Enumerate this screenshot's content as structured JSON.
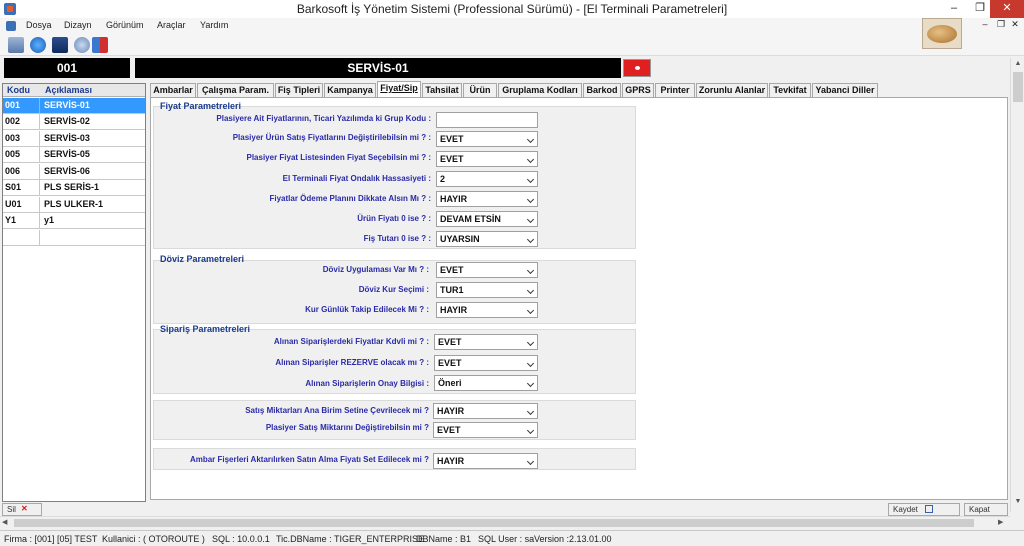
{
  "window": {
    "title": "Barkosoft İş Yönetim Sistemi (Professional Sürümü) - [El Terminali Parametreleri]",
    "minimize": "–",
    "restore": "❐",
    "close": "✕"
  },
  "menu": {
    "items": [
      "Dosya",
      "Dizayn",
      "Görünüm",
      "Araçlar",
      "Yardım"
    ],
    "mdi_minimize": "–",
    "mdi_restore": "❐",
    "mdi_close": "✕"
  },
  "toolbar": {
    "icons": [
      "users-icon",
      "globe-icon",
      "monitor-icon",
      "network-icon",
      "exit-icon"
    ]
  },
  "header": {
    "code": "001",
    "name": "SERVİS-01"
  },
  "list": {
    "col_code": "Kodu",
    "col_desc": "Açıklaması",
    "rows": [
      {
        "code": "001",
        "desc": "SERVİS-01"
      },
      {
        "code": "002",
        "desc": "SERVİS-02"
      },
      {
        "code": "003",
        "desc": "SERVİS-03"
      },
      {
        "code": "005",
        "desc": "SERVİS-05"
      },
      {
        "code": "006",
        "desc": "SERVİS-06"
      },
      {
        "code": "S01",
        "desc": "PLS SERİS-1"
      },
      {
        "code": "U01",
        "desc": "PLS ULKER-1"
      },
      {
        "code": "Y1",
        "desc": "y1"
      },
      {
        "code": "",
        "desc": ""
      }
    ]
  },
  "tabs": [
    "Ambarlar",
    "Çalışma Param.",
    "Fiş Tipleri",
    "Kampanya",
    "Fiyat/Sip",
    "Tahsilat",
    "Ürün",
    "Gruplama Kodları",
    "Barkod",
    "GPRS",
    "Printer",
    "Zorunlu Alanlar",
    "Tevkifat",
    "Yabanci Diller"
  ],
  "active_tab": "Fiyat/Sip",
  "fiyat": {
    "title": "Fiyat  Parametreleri",
    "f1_label": "Plasiyere Ait Fiyatlarının, Ticari Yazılımda ki Grup Kodu :",
    "f1_value": "",
    "f2_label": "Plasiyer Ürün Satış Fiyatlarını Değiştirilebilsin mi ? :",
    "f2_value": "EVET",
    "f3_label": "Plasiyer Fiyat Listesinden Fiyat Seçebilsin mi ? :",
    "f3_value": "EVET",
    "f4_label": "El Terminali Fiyat Ondalık Hassasiyeti :",
    "f4_value": "2",
    "f5_label": "Fiyatlar Ödeme Planını Dikkate Alsın Mı ? :",
    "f5_value": "HAYIR",
    "f6_label": "Ürün Fiyatı 0 ise ? :",
    "f6_value": "DEVAM ETSİN",
    "f7_label": "Fiş Tutarı 0 ise ? :",
    "f7_value": "UYARSIN"
  },
  "doviz": {
    "title": "Döviz Parametreleri",
    "d1_label": "Döviz Uygulaması Var Mı ? :",
    "d1_value": "EVET",
    "d2_label": "Döviz Kur Seçimi :",
    "d2_value": "TUR1",
    "d3_label": "Kur Günlük Takip Edilecek Mi ? :",
    "d3_value": "HAYIR"
  },
  "siparis": {
    "title": "Sipariş  Parametreleri",
    "s1_label": "Alınan Siparişlerdeki Fiyatlar Kdvli mi ? :",
    "s1_value": "EVET",
    "s2_label": "Alınan Siparişler REZERVE olacak mı ? :",
    "s2_value": "EVET",
    "s3_label": "Alınan Siparişlerin Onay Bilgisi :",
    "s3_value": "Öneri"
  },
  "satis": {
    "m1_label": "Satış Miktarları Ana Birim Setine Çevrilecek mi ?",
    "m1_value": "HAYIR",
    "m2_label": "Plasiyer Satış Miktarını Değiştirebilsin mi ?",
    "m2_value": "EVET"
  },
  "ambar": {
    "a1_label": "Ambar Fişerleri Aktarılırken Satın Alma Fiyatı Set Edilecek mi ?",
    "a1_value": "HAYIR"
  },
  "bottom": {
    "left_button": "Sil",
    "save_button": "Kaydet",
    "close_button": "Kapat"
  },
  "status": {
    "firma": "Firma : [001] [05]  TEST",
    "kullanici": "Kullanici : ( OTOROUTE )",
    "sql": "SQL : 10.0.0.1",
    "tic_db": "Tic.DBName : TIGER_ENTERPRISE",
    "db": "DBName : B1",
    "sql_user": "SQL User : sa",
    "version": "Version :2.13.01.00"
  }
}
